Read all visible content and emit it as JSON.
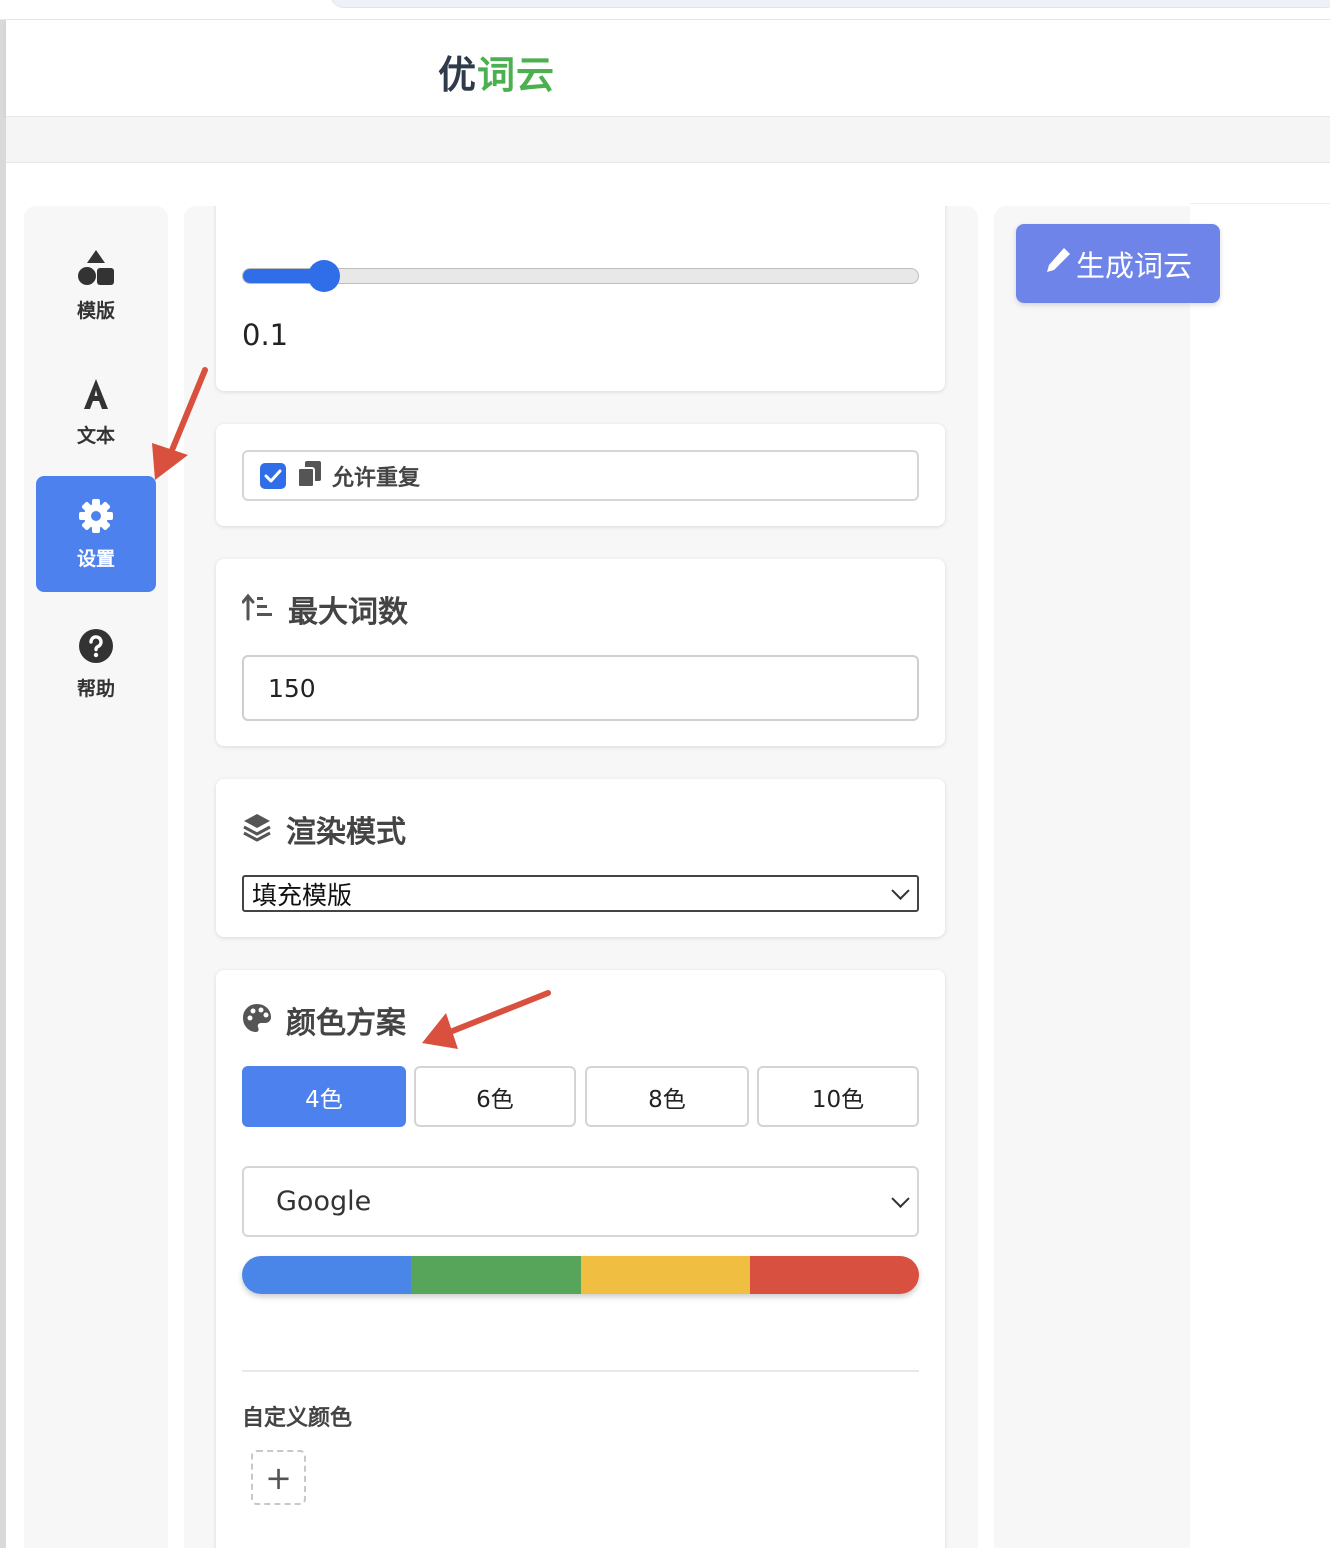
{
  "app": {
    "logo_part1": "优",
    "logo_part2": "词云"
  },
  "sidebar": {
    "items": [
      {
        "label": "模版",
        "icon": "shapes-icon",
        "active": false
      },
      {
        "label": "文本",
        "icon": "font-icon",
        "active": false
      },
      {
        "label": "设置",
        "icon": "gear-icon",
        "active": true
      },
      {
        "label": "帮助",
        "icon": "question-circle-icon",
        "active": false
      }
    ]
  },
  "settings": {
    "slider": {
      "value_text": "0.1",
      "fill_fraction": 0.12
    },
    "allow_repeat": {
      "label": "允许重复",
      "checked": true,
      "icon": "copy-icon"
    },
    "max_words": {
      "title": "最大词数",
      "value": "150",
      "icon": "sort-amount-up-icon"
    },
    "render_mode": {
      "title": "渲染模式",
      "selected": "填充模版",
      "icon": "layers-icon"
    },
    "color_scheme": {
      "title": "颜色方案",
      "icon": "palette-icon",
      "options": [
        "4色",
        "6色",
        "8色",
        "10色"
      ],
      "active_option": "4色",
      "preset_selected": "Google",
      "swatches": [
        "#4a86e8",
        "#57a55a",
        "#f0be41",
        "#d8503f"
      ],
      "custom_label": "自定义颜色",
      "add_label": "+"
    }
  },
  "actions": {
    "generate_label": "生成词云",
    "generate_icon": "pencil-icon"
  },
  "colors": {
    "accent": "#4d82ee",
    "generate_button": "#6e84e8",
    "logo_green": "#4caf50",
    "annotation_arrow": "#d9503f"
  }
}
